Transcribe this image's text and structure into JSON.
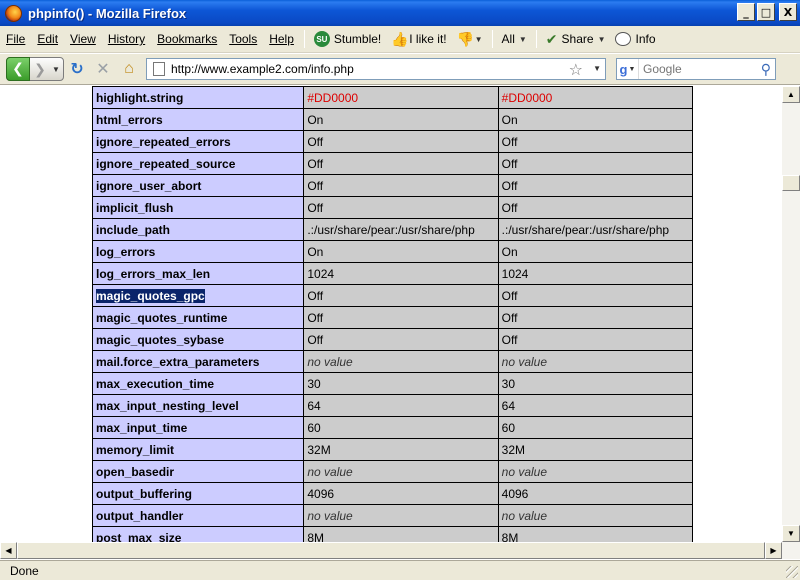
{
  "window": {
    "title": "phpinfo() - Mozilla Firefox",
    "minimize": "_",
    "maximize": "□",
    "close": "X"
  },
  "menubar": {
    "items": [
      {
        "label": "File"
      },
      {
        "label": "Edit"
      },
      {
        "label": "View"
      },
      {
        "label": "History"
      },
      {
        "label": "Bookmarks"
      },
      {
        "label": "Tools"
      },
      {
        "label": "Help"
      }
    ],
    "stumble_label": "Stumble!",
    "ilike_label": "I like it!",
    "all_label": "All",
    "share_label": "Share",
    "info_label": "Info"
  },
  "navbar": {
    "url": "http://www.example2.com/info.php",
    "search_placeholder": "Google"
  },
  "table": {
    "rows": [
      {
        "name": "highlight.string",
        "local": "#DD0000",
        "master": "#DD0000",
        "style": "red"
      },
      {
        "name": "html_errors",
        "local": "On",
        "master": "On",
        "style": ""
      },
      {
        "name": "ignore_repeated_errors",
        "local": "Off",
        "master": "Off",
        "style": ""
      },
      {
        "name": "ignore_repeated_source",
        "local": "Off",
        "master": "Off",
        "style": ""
      },
      {
        "name": "ignore_user_abort",
        "local": "Off",
        "master": "Off",
        "style": ""
      },
      {
        "name": "implicit_flush",
        "local": "Off",
        "master": "Off",
        "style": ""
      },
      {
        "name": "include_path",
        "local": ".:/usr/share/pear:/usr/share/php",
        "master": ".:/usr/share/pear:/usr/share/php",
        "style": ""
      },
      {
        "name": "log_errors",
        "local": "On",
        "master": "On",
        "style": ""
      },
      {
        "name": "log_errors_max_len",
        "local": "1024",
        "master": "1024",
        "style": ""
      },
      {
        "name": "magic_quotes_gpc",
        "local": "Off",
        "master": "Off",
        "style": "",
        "selected": true
      },
      {
        "name": "magic_quotes_runtime",
        "local": "Off",
        "master": "Off",
        "style": ""
      },
      {
        "name": "magic_quotes_sybase",
        "local": "Off",
        "master": "Off",
        "style": ""
      },
      {
        "name": "mail.force_extra_parameters",
        "local": "no value",
        "master": "no value",
        "style": "italic"
      },
      {
        "name": "max_execution_time",
        "local": "30",
        "master": "30",
        "style": ""
      },
      {
        "name": "max_input_nesting_level",
        "local": "64",
        "master": "64",
        "style": ""
      },
      {
        "name": "max_input_time",
        "local": "60",
        "master": "60",
        "style": ""
      },
      {
        "name": "memory_limit",
        "local": "32M",
        "master": "32M",
        "style": ""
      },
      {
        "name": "open_basedir",
        "local": "no value",
        "master": "no value",
        "style": "italic"
      },
      {
        "name": "output_buffering",
        "local": "4096",
        "master": "4096",
        "style": ""
      },
      {
        "name": "output_handler",
        "local": "no value",
        "master": "no value",
        "style": "italic"
      },
      {
        "name": "post_max_size",
        "local": "8M",
        "master": "8M",
        "style": ""
      }
    ]
  },
  "status": {
    "text": "Done"
  },
  "colors": {
    "name_cell": "#ccccff",
    "value_cell": "#cccccc",
    "highlight_value": "#dd0000",
    "selection": "#0a246a"
  }
}
